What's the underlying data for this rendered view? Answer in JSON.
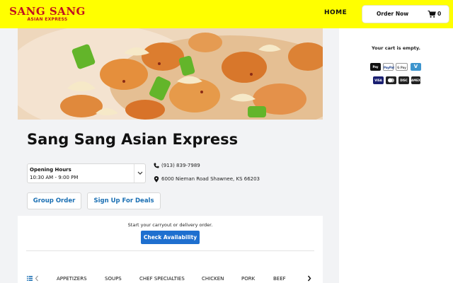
{
  "header": {
    "logo_line1": "SANG SANG",
    "logo_line2": "ASIAN EXPRESS",
    "home_label": "HOME",
    "order_now_label": "Order Now",
    "cart_count": "0"
  },
  "restaurant": {
    "name": "Sang Sang Asian Express",
    "hours_label": "Opening Hours",
    "hours_value": "10:30 AM - 9:00 PM",
    "phone": "(913) 839-7989",
    "address": "6000 Nieman Road Shawnee, KS 66203"
  },
  "actions": {
    "group_order": "Group Order",
    "sign_up": "Sign Up For Deals"
  },
  "availability": {
    "prompt": "Start your carryout or delivery order.",
    "button": "Check Availability"
  },
  "categories": [
    "APPETIZERS",
    "SOUPS",
    "CHEF SPECIALTIES",
    "CHICKEN",
    "PORK",
    "BEEF"
  ],
  "cart": {
    "empty_text": "Your cart is empty.",
    "payment_icons": [
      "apple-pay",
      "paypal",
      "google-pay",
      "venmo",
      "visa",
      "mastercard",
      "discover",
      "amex"
    ]
  },
  "colors": {
    "header_bg": "#ffff00",
    "brand_red": "#c1121f",
    "link_blue": "#1a6fb3",
    "button_blue": "#1e6fcf"
  }
}
